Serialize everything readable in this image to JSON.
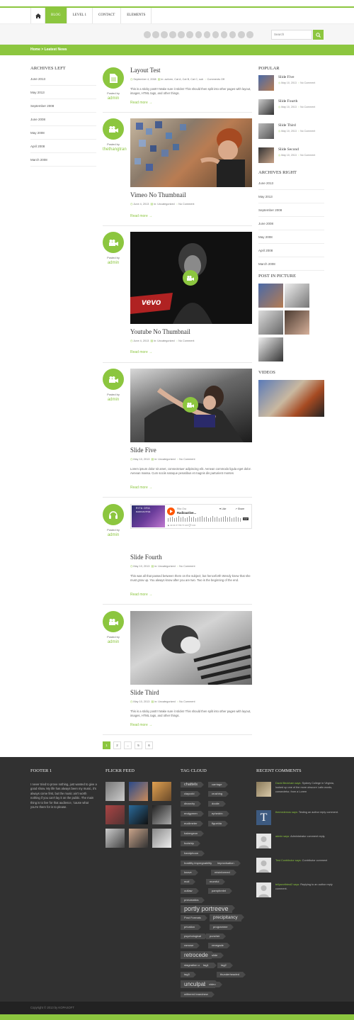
{
  "nav": {
    "items": [
      "BLOG",
      "LEVEL 1",
      "CONTACT",
      "ELEMENTS"
    ]
  },
  "search": {
    "placeholder": "Search"
  },
  "breadcrumb": "Home > Leatest News",
  "archives_left": {
    "title": "ARCHIVES LEFT",
    "items": [
      "June 2013",
      "May 2013",
      "September 2008",
      "June 2008",
      "May 2008",
      "April 2008",
      "March 2008"
    ]
  },
  "posts": [
    {
      "title": "Layout Test",
      "date": "September 4, 2008",
      "cats": "in: acform, Cat A, Cat B, Cat C, sub",
      "comments": "Comments Off",
      "author": "admin",
      "excerpt": "This is a sticky post!!! Make sure it sticks! This should then split into other pages with layout, images, HTML tags, and other things.",
      "more": "Read more",
      "icon": "document-icon"
    },
    {
      "title": "Vimeo No Thumbnail",
      "date": "June 4, 2013",
      "cats": "in: Uncategorized",
      "comments": "No Comment",
      "author": "thethangtran",
      "excerpt": "",
      "more": "Read more",
      "icon": "video-icon"
    },
    {
      "title": "Youtube No Thumbnail",
      "date": "June 4, 2013",
      "cats": "in: Uncategorized",
      "comments": "No Comment",
      "author": "admin",
      "excerpt": "",
      "more": "Read more",
      "icon": "video-icon"
    },
    {
      "title": "Slide Five",
      "date": "May 10, 2013",
      "cats": "in: Uncategorized",
      "comments": "No Comment",
      "author": "admin",
      "excerpt": "Lorem ipsum dolor sit amet, consectetuer adipiscing elit. Aenean commodo ligula eget dolor. Aenean massa. Cum sociis natoque penatibus et magnis dis parturient montes",
      "more": "Read more",
      "icon": "video-icon"
    },
    {
      "title": "Slide Fourth",
      "date": "May 10, 2013",
      "cats": "in: Uncategorized",
      "comments": "No Comment",
      "author": "admin",
      "excerpt": "This was all that passed between them on the subject; but henceforth Wendy knew that she must grow up. You always know after you are two. Two is the beginning of the end.",
      "more": "Read more",
      "icon": "headphones-icon"
    },
    {
      "title": "Slide Third",
      "date": "May 10, 2013",
      "cats": "in: Uncategorized",
      "comments": "No Comment",
      "author": "admin",
      "excerpt": "This is a sticky post!!! Make sure it sticks! This should then split into other pages with layout, images, HTML tags, and other things.",
      "more": "Read more",
      "icon": "video-icon"
    }
  ],
  "posted_by": "Posted by",
  "video_brand": "vevo",
  "audio": {
    "artist": "Rita Ora",
    "track": "Radioactive...",
    "cover_title": "RITA ORA",
    "cover_sub": "RADIOACTIVE",
    "like": "Like",
    "share": "Share",
    "time": "3:47",
    "stats": "▶ 43.3K   ♥ 756   ⟲ 143   💬 104"
  },
  "pagination": [
    "1",
    "2",
    "...",
    "5",
    "6"
  ],
  "popular": {
    "title": "POPULAR",
    "items": [
      {
        "title": "Slide Five",
        "date": "May 10, 2013",
        "comments": "No Comment"
      },
      {
        "title": "Slide Fourth",
        "date": "May 10, 2013",
        "comments": "No Comment"
      },
      {
        "title": "Slide Third",
        "date": "May 10, 2013",
        "comments": "No Comment"
      },
      {
        "title": "Slide Second",
        "date": "May 10, 2013",
        "comments": "No Comment"
      }
    ]
  },
  "archives_right": {
    "title": "ARCHIVES RIGHT",
    "items": [
      "June 2013",
      "May 2013",
      "September 2008",
      "June 2008",
      "May 2008",
      "April 2008",
      "March 2008"
    ]
  },
  "post_in_picture": {
    "title": "POST IN PICTURE"
  },
  "videos": {
    "title": "VIDEOS"
  },
  "footer": {
    "col1": {
      "title": "FOOTER 1",
      "text": "I never tried to prove nothing, just wanted to give a good show. My life has always been my music, it's always come first, but the music ain't worth nothing if you can't lay it on the public. The main thing is to live for that audience, 'cause what you're there for is to please."
    },
    "flickr": {
      "title": "FLICKR FEED"
    },
    "tags": {
      "title": "TAG CLOUD",
      "items": [
        "chattels",
        "carriage",
        "claycold",
        "crushing",
        "dinarchy",
        "doolie",
        "endgymen",
        "ephedrin",
        "euclimeter",
        "figuelda",
        "habergeon",
        "foolship",
        "handphoon",
        "hostility impregnability",
        "improvisation",
        "knave",
        "misinformed",
        "moil",
        "mornful",
        "outlaw",
        "pamphrelet",
        "pneumatics",
        "portly portreeve",
        "Post Formats",
        "precipitancy",
        "privation",
        "programme",
        "psychological",
        "puncher",
        "ramose",
        "renegade",
        "retrocede",
        "slide",
        "stagnation unhoused",
        "tag1",
        "tag2",
        "tag3",
        "thunderheaded",
        "unculpable",
        "video",
        "withered brandnew",
        "xanthopsia"
      ]
    },
    "recent": {
      "title": "RECENT COMMENTS",
      "items": [
        {
          "who": "David Beckham says:",
          "text": "Sydney College in Virginia, looked up one of the more obscure Latin words, consectetur, from a Lorem"
        },
        {
          "who": "themedemos says:",
          "text": "Testing an author reply comment."
        },
        {
          "who": "admin says:",
          "text": "Administrator comment reply."
        },
        {
          "who": "Test Contributor says:",
          "text": "Contributor comment"
        },
        {
          "who": "tellyworthtest2 says:",
          "text": "Replying to an author reply comment."
        }
      ]
    }
  },
  "copyright": "Copyright © 2013 by KOPASOFT",
  "colors": {
    "accent": "#8cc63f",
    "footer": "#313131"
  }
}
